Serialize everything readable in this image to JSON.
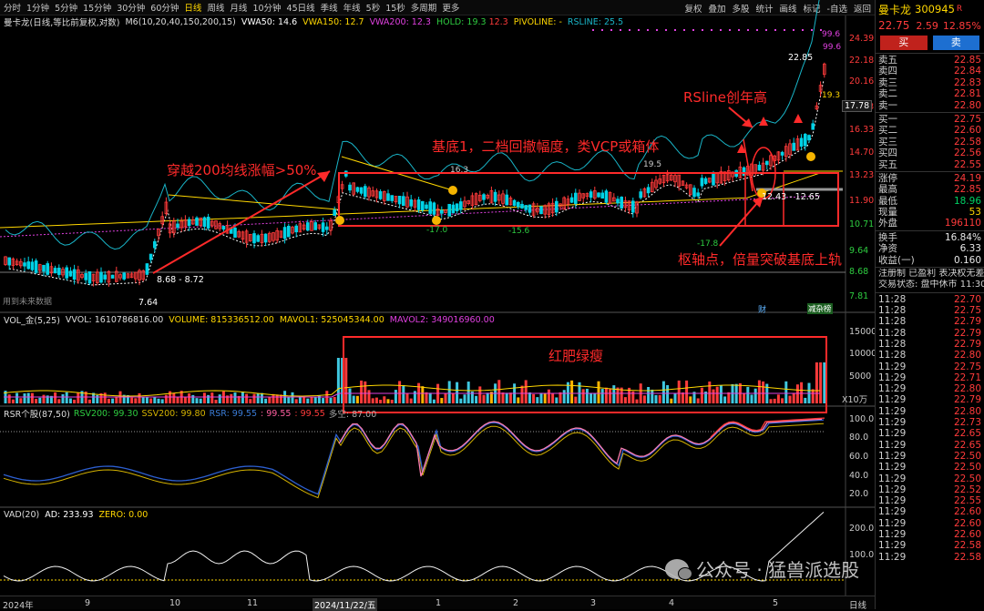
{
  "top": {
    "periods": [
      "分时",
      "1分钟",
      "5分钟",
      "15分钟",
      "30分钟",
      "60分钟",
      "日线",
      "周线",
      "月线",
      "10分钟",
      "45日线",
      "季线",
      "年线",
      "5秒",
      "15秒",
      "多周期",
      "更多"
    ],
    "active_period": "日线",
    "tools": [
      "复权",
      "叠加",
      "多股",
      "统计",
      "画线",
      "标记",
      "-自选",
      "返回"
    ]
  },
  "main_legend": {
    "name": "曼卡龙(日线,等比前复权,对数)",
    "ma": "M6(10,20,40,150,200,15)",
    "vwa50": "VWA50: 14.6",
    "vwa150": "VWA150: 12.7",
    "vwa200": "VWA200: 12.3",
    "hold": "HOLD: 19.3",
    "hold2": "12.3",
    "pivoline": "PIVOLINE: -",
    "rsline": "RSLINE: 25.5"
  },
  "price_axis": [
    "24.39",
    "22.18",
    "20.16",
    "18.33",
    "16.33",
    "14.70",
    "13.23",
    "11.90",
    "10.71",
    "9.64",
    "8.68",
    "7.81"
  ],
  "price_tag": "17.78",
  "chart_labels": {
    "hi_2285": "22.85",
    "v996a": "99.6",
    "v996b": "99.6",
    "v193": "19.3",
    "v195": "19.5",
    "v163": "16.3",
    "lo_176": "-17.0",
    "lo_156": "-15.6",
    "lo_178": "-17.8",
    "range": "12.43 - 12.65",
    "base_range": "8.68 - 8.72",
    "low_764": "7.64",
    "future": "用到未来数据",
    "cai": "财",
    "jianchi": "减杂榜"
  },
  "annotations": {
    "a1": "穿越200均线涨幅>50%",
    "a2": "基底1，二档回撤幅度，类VCP或箱体",
    "a3": "RSline创年高",
    "a4": "枢轴点，倍量突破基底上轨",
    "a5": "红肥绿瘦"
  },
  "vol_legend": {
    "name": "VOL_金(5,25)",
    "vvol": "VVOL: 1610786816.00",
    "volume": "VOLUME: 815336512.00",
    "mavol1": "MAVOL1: 525045344.00",
    "mavol2": "MAVOL2: 349016960.00"
  },
  "vol_axis": [
    "15000",
    "10000",
    "5000",
    "X10万"
  ],
  "rsr_legend": {
    "name": "RSR个股(87,50)",
    "rsv200": "RSV200: 99.30",
    "ssv200": "SSV200: 99.80",
    "rsr": "RSR: 99.55",
    "rsr2": ": 99.55",
    "rsr3": ": 99.55",
    "duokong": "多空: 87.00"
  },
  "rsr_axis": [
    "100.0",
    "80.0",
    "60.0",
    "40.0",
    "20.0"
  ],
  "vad_legend": {
    "name": "VAD(20)",
    "ad": "AD: 233.93",
    "zero": "ZERO: 0.00"
  },
  "vad_axis": [
    "200.0",
    "100.0"
  ],
  "watermark": "公众号 · 猛兽派选股",
  "x_axis": [
    "2024年",
    "9",
    "10",
    "11",
    "2024/11/22/五",
    "1",
    "2",
    "3",
    "4",
    "5"
  ],
  "x_axis_right": "日线",
  "right_panel": {
    "name": "曼卡龙",
    "code": "300945",
    "r_badge": "R",
    "price": "22.75",
    "change": "2.59",
    "pct": "12.85%",
    "buy": "买",
    "sell": "卖",
    "asks": [
      {
        "label": "卖五",
        "price": "22.85"
      },
      {
        "label": "卖四",
        "price": "22.84"
      },
      {
        "label": "卖三",
        "price": "22.83"
      },
      {
        "label": "卖二",
        "price": "22.81"
      },
      {
        "label": "卖一",
        "price": "22.80"
      }
    ],
    "bids": [
      {
        "label": "买一",
        "price": "22.75"
      },
      {
        "label": "买二",
        "price": "22.60"
      },
      {
        "label": "买三",
        "price": "22.58"
      },
      {
        "label": "买四",
        "price": "22.56"
      },
      {
        "label": "买五",
        "price": "22.55"
      }
    ],
    "stats1": [
      {
        "label": "涨停",
        "value": "24.19",
        "cls": "red"
      },
      {
        "label": "最高",
        "value": "22.85",
        "cls": "red"
      },
      {
        "label": "最低",
        "value": "18.96",
        "cls": "green"
      },
      {
        "label": "现量",
        "value": "53",
        "cls": "yellow"
      },
      {
        "label": "外盘",
        "value": "196110",
        "cls": "red"
      }
    ],
    "stats2": [
      {
        "label": "换手",
        "value": "16.84%",
        "cls": "white"
      },
      {
        "label": "净资",
        "value": "6.33",
        "cls": "white"
      },
      {
        "label": "收益(一)",
        "value": "0.160",
        "cls": "white"
      }
    ],
    "reg": "注册制 已盈利 表决权无差",
    "status": "交易状态: 盘中休市 11:30",
    "ticks": [
      {
        "t": "11:28",
        "p": "22.70"
      },
      {
        "t": "11:28",
        "p": "22.75"
      },
      {
        "t": "11:28",
        "p": "22.79"
      },
      {
        "t": "11:28",
        "p": "22.79"
      },
      {
        "t": "11:28",
        "p": "22.79"
      },
      {
        "t": "11:28",
        "p": "22.80"
      },
      {
        "t": "11:29",
        "p": "22.75"
      },
      {
        "t": "11:29",
        "p": "22.71"
      },
      {
        "t": "11:29",
        "p": "22.80"
      },
      {
        "t": "11:29",
        "p": "22.79"
      },
      {
        "t": "11:29",
        "p": "22.80"
      },
      {
        "t": "11:29",
        "p": "22.73"
      },
      {
        "t": "11:29",
        "p": "22.65"
      },
      {
        "t": "11:29",
        "p": "22.65"
      },
      {
        "t": "11:29",
        "p": "22.50"
      },
      {
        "t": "11:29",
        "p": "22.50"
      },
      {
        "t": "11:29",
        "p": "22.50"
      },
      {
        "t": "11:29",
        "p": "22.52"
      },
      {
        "t": "11:29",
        "p": "22.55"
      },
      {
        "t": "11:29",
        "p": "22.60"
      },
      {
        "t": "11:29",
        "p": "22.60"
      },
      {
        "t": "11:29",
        "p": "22.60"
      },
      {
        "t": "11:29",
        "p": "22.58"
      },
      {
        "t": "11:29",
        "p": "22.58"
      }
    ]
  },
  "colors": {
    "up": "#ff3b3b",
    "down": "#00d2e6",
    "annot_red": "#ff2a2a",
    "gold": "#ffd700",
    "magenta": "#e040e0"
  }
}
